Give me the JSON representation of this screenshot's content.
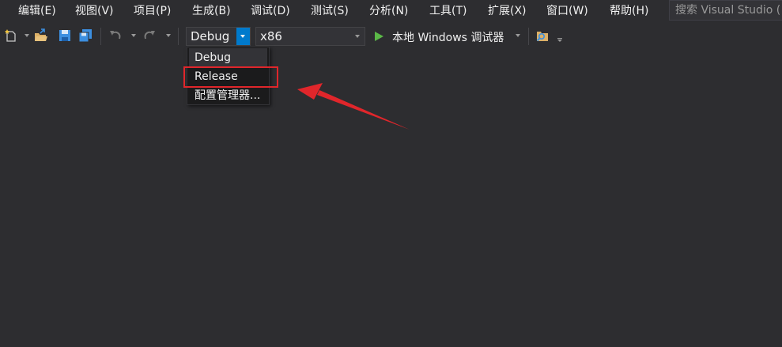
{
  "menu": {
    "items": [
      "编辑(E)",
      "视图(V)",
      "项目(P)",
      "生成(B)",
      "调试(D)",
      "测试(S)",
      "分析(N)",
      "工具(T)",
      "扩展(X)",
      "窗口(W)",
      "帮助(H)"
    ],
    "search_placeholder": "搜索 Visual Studio ("
  },
  "toolbar": {
    "configuration": "Debug",
    "platform": "x86",
    "run_label": "本地 Windows 调试器",
    "icons": [
      "new-project-icon",
      "open-folder-icon",
      "save-icon",
      "save-all-icon",
      "undo-icon",
      "redo-icon",
      "play-icon",
      "find-in-files-icon"
    ]
  },
  "dropdown": {
    "options": [
      "Debug",
      "Release",
      "配置管理器..."
    ],
    "selected": "Debug",
    "highlighted": "Release"
  },
  "colors": {
    "background": "#2d2d30",
    "accent": "#007acc",
    "annotation": "#e0262b",
    "play": "#5bb847"
  }
}
